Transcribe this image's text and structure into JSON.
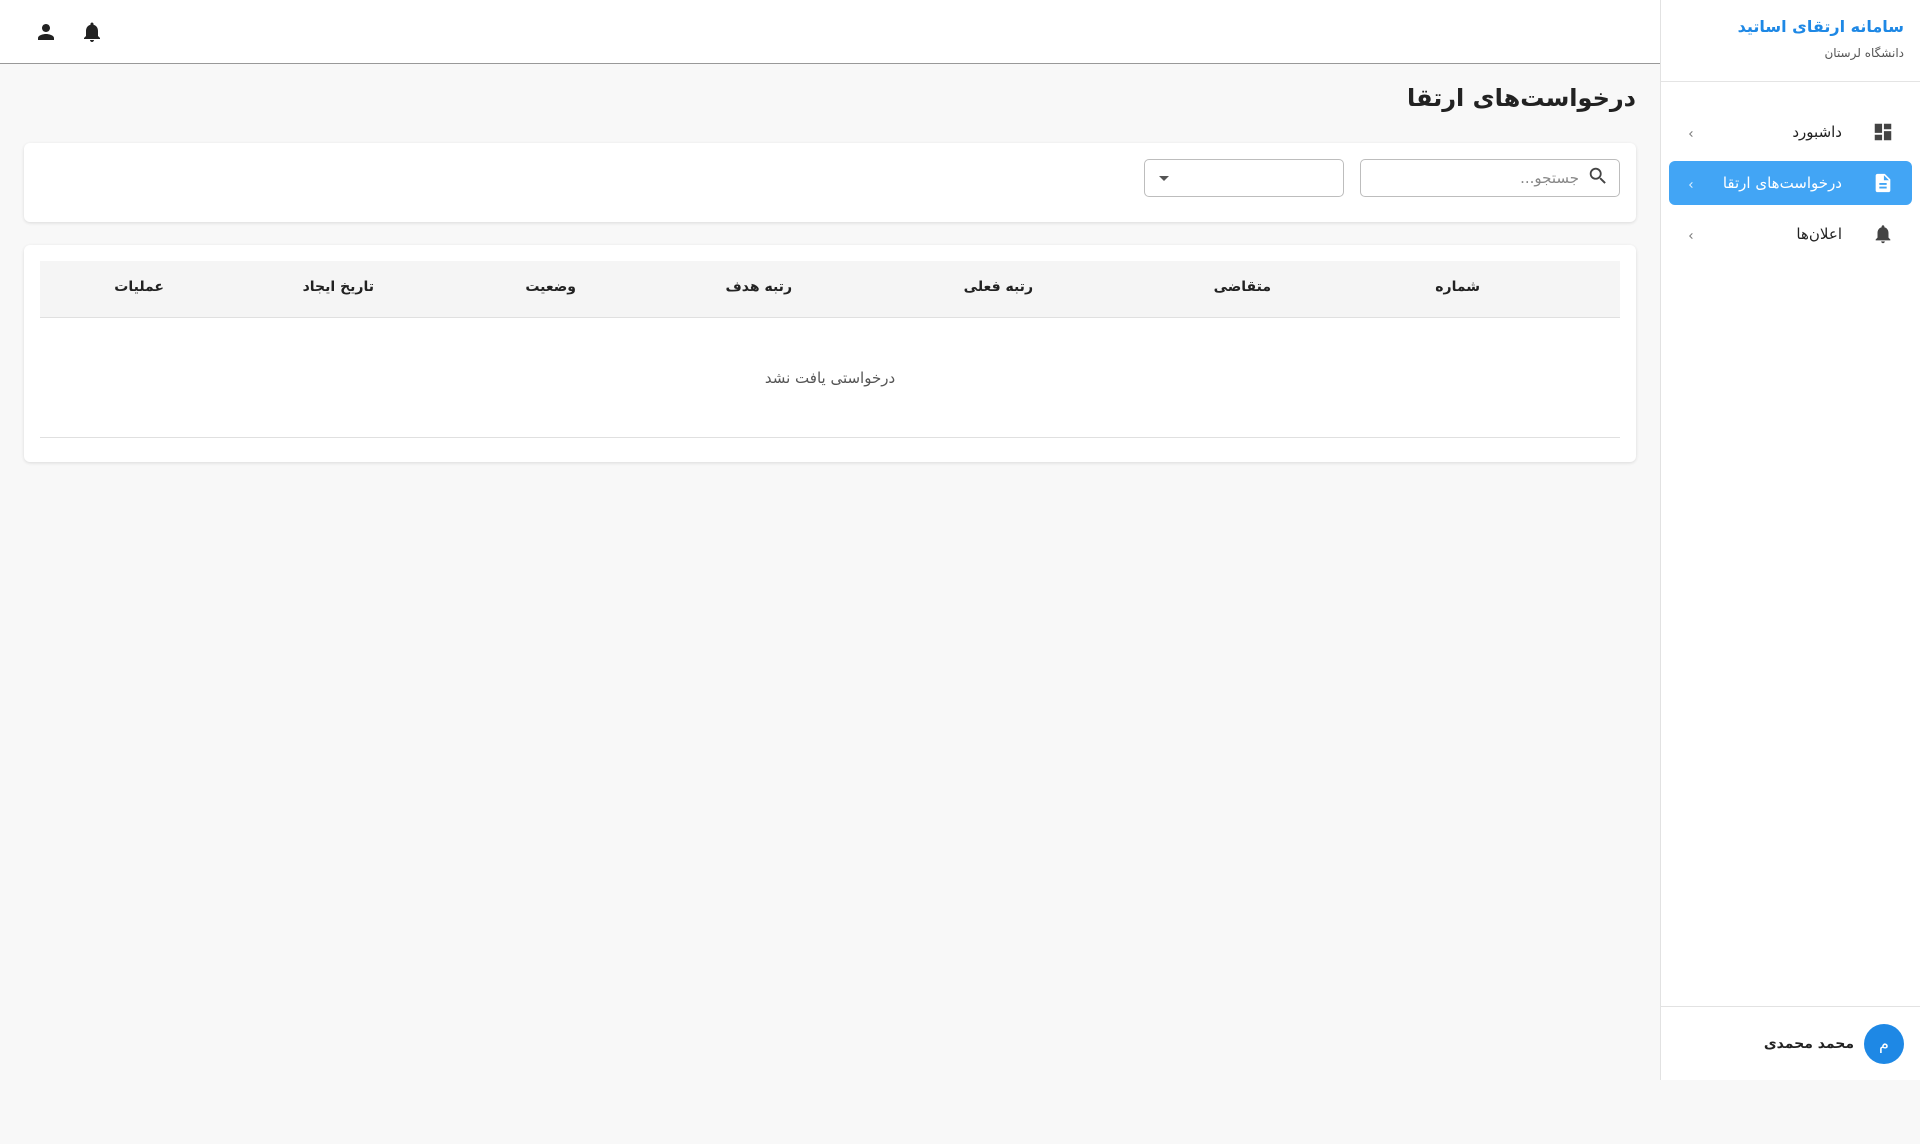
{
  "sidebar": {
    "title": "سامانه ارتقای اساتید",
    "subtitle": "دانشگاه لرستان",
    "items": [
      {
        "label": "داشبورد",
        "icon": "dashboard-icon",
        "active": false
      },
      {
        "label": "درخواست‌های ارتقا",
        "icon": "document-icon",
        "active": true
      },
      {
        "label": "اعلان‌ها",
        "icon": "bell-icon",
        "active": false
      }
    ],
    "user": {
      "initial": "م",
      "name": "محمد محمدی"
    }
  },
  "topbar": {
    "icons": [
      "bell-icon",
      "person-icon"
    ]
  },
  "main": {
    "title": "درخواست‌های ارتقا",
    "search": {
      "placeholder": "جستجو...",
      "value": ""
    },
    "filter": {
      "selected": ""
    },
    "table": {
      "columns": [
        "شماره",
        "متقاضی",
        "رتبه فعلی",
        "رتبه هدف",
        "وضعیت",
        "تاریخ ایجاد",
        "عملیات"
      ],
      "empty_message": "درخواستی یافت نشد"
    }
  },
  "colors": {
    "accent": "#1e88e5",
    "active_item": "#42a5f5",
    "background": "#f8f8f8"
  }
}
